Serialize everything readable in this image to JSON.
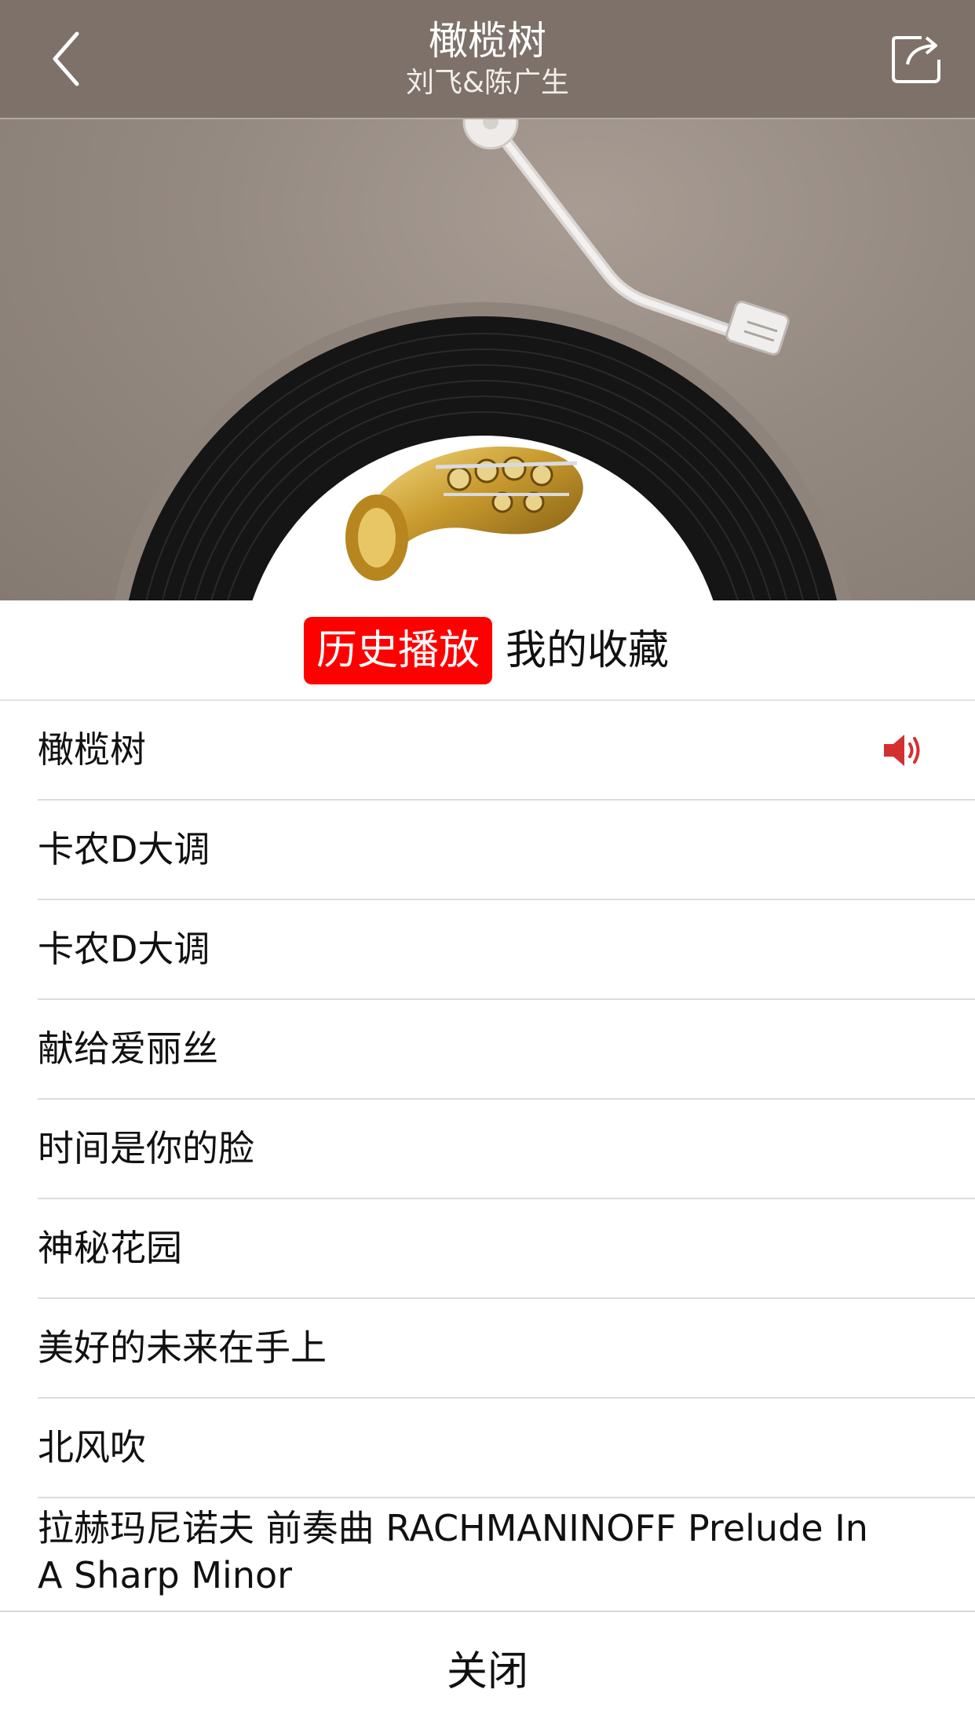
{
  "header": {
    "title": "橄榄树",
    "artist": "刘飞&陈广生",
    "back_icon": "chevron-left-icon",
    "share_icon": "share-icon"
  },
  "tabs": [
    {
      "label": "历史播放",
      "active": true
    },
    {
      "label": "我的收藏",
      "active": false
    }
  ],
  "playlist": [
    {
      "title": "橄榄树",
      "playing": true
    },
    {
      "title": "卡农D大调"
    },
    {
      "title": "卡农D大调"
    },
    {
      "title": "献给爱丽丝"
    },
    {
      "title": "时间是你的脸"
    },
    {
      "title": "神秘花园"
    },
    {
      "title": "美好的未来在手上"
    },
    {
      "title": "北风吹"
    },
    {
      "title": "拉赫玛尼诺夫 前奏曲 RACHMANINOFF Prelude In A Sharp Minor"
    }
  ],
  "close_label": "关闭",
  "colors": {
    "accent": "#ff0000",
    "playing_icon": "#d32f2f",
    "topbar": "#7d716a"
  }
}
